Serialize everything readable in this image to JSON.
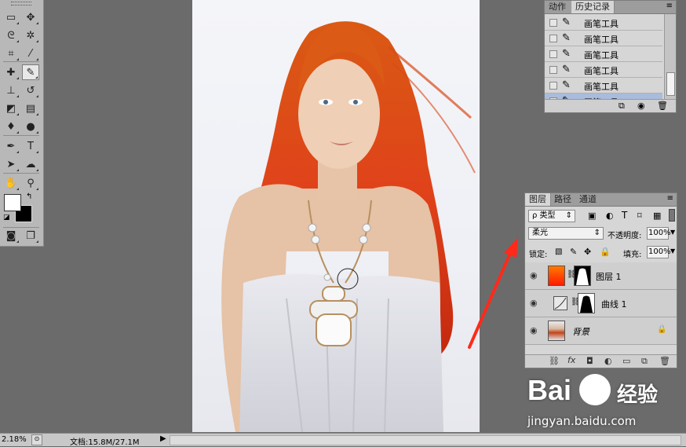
{
  "tools": {
    "icons": [
      "marquee-icon",
      "move-icon",
      "lasso-icon",
      "magic-wand-icon",
      "crop-icon",
      "eyedropper-icon",
      "healing-icon",
      "brush-icon",
      "stamp-icon",
      "history-brush-icon",
      "eraser-icon",
      "gradient-icon",
      "blur-icon",
      "dodge-icon",
      "pen-icon",
      "type-icon",
      "path-select-icon",
      "shape-icon",
      "hand-icon",
      "zoom-icon"
    ],
    "type_glyph": "T",
    "foreground_color": "#ffffff",
    "background_color": "#000000"
  },
  "history": {
    "tab_actions": "动作",
    "tab_history": "历史记录",
    "items": [
      {
        "label": "画笔工具"
      },
      {
        "label": "画笔工具"
      },
      {
        "label": "画笔工具"
      },
      {
        "label": "画笔工具"
      },
      {
        "label": "画笔工具"
      },
      {
        "label": "画笔工具"
      }
    ],
    "selected_index": 5
  },
  "layers": {
    "tab_layers": "图层",
    "tab_paths": "路径",
    "tab_channels": "通道",
    "filter_label": "ρ 类型",
    "filter_icons": [
      "T"
    ],
    "blend_mode": "柔光",
    "opacity_label": "不透明度:",
    "opacity_value": "100%",
    "lock_label": "锁定:",
    "fill_label": "填充:",
    "fill_value": "100%",
    "items": [
      {
        "name": "图层 1",
        "selected": true,
        "thumb_color": "#ff4a00"
      },
      {
        "name": "曲线 1",
        "selected": false
      },
      {
        "name": "背景",
        "selected": false,
        "locked": true
      }
    ],
    "bottom_fx": "fx"
  },
  "status": {
    "zoom": "2.18%",
    "doc_info": "文档:15.8M/27.1M"
  },
  "watermark": {
    "brand": "Bai",
    "brand2": "经验",
    "url": "jingyan.baidu.com"
  },
  "colors": {
    "accent_selected": "#a9bcdc",
    "arrow": "#ff2a1a",
    "hair": "#e0421a"
  }
}
